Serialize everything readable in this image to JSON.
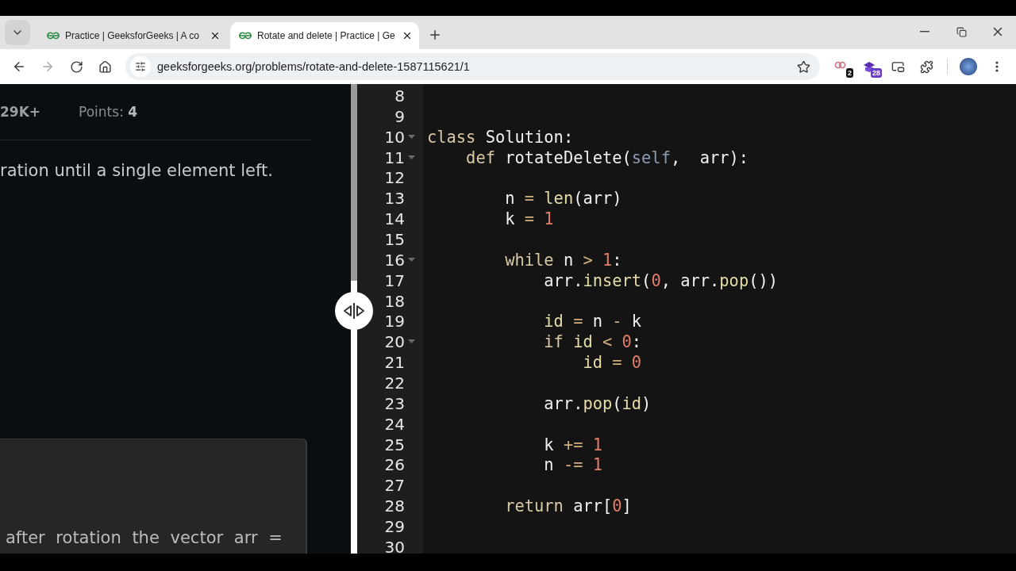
{
  "browser": {
    "tabs": [
      {
        "title": "Practice | GeeksforGeeks | A co",
        "selected": false
      },
      {
        "title": "Rotate and delete | Practice | Ge",
        "selected": true
      }
    ],
    "forward_disabled": true,
    "url": "geeksforgeeks.org/problems/rotate-and-delete-1587115621/1",
    "extensions": [
      {
        "kind": "rings",
        "badge": "2"
      },
      {
        "kind": "cap",
        "badge": "28"
      }
    ]
  },
  "problem": {
    "stats": [
      {
        "value": "29K+"
      },
      {
        "label": "Points:",
        "value": "4"
      }
    ],
    "description": "ration until a single element left.",
    "example_text": "after rotation the vector arr ="
  },
  "editor": {
    "lines": [
      {
        "number": "8"
      },
      {
        "number": "9"
      },
      {
        "number": "10",
        "foldable": true,
        "tokens": [
          {
            "kind": "keyword",
            "text": "class "
          },
          {
            "kind": "plain",
            "text": "Solution:"
          }
        ]
      },
      {
        "number": "11",
        "foldable": true,
        "tokens": [
          {
            "kind": "keyword",
            "text": "    def "
          },
          {
            "kind": "plain",
            "text": "rotateDelete("
          },
          {
            "kind": "self",
            "text": "self"
          },
          {
            "kind": "plain",
            "text": ",  arr):"
          }
        ]
      },
      {
        "number": "12"
      },
      {
        "number": "13",
        "tokens": [
          {
            "kind": "plain",
            "text": "        n "
          },
          {
            "kind": "operator",
            "text": "= "
          },
          {
            "kind": "function",
            "text": "len"
          },
          {
            "kind": "plain",
            "text": "(arr)"
          }
        ]
      },
      {
        "number": "14",
        "tokens": [
          {
            "kind": "plain",
            "text": "        k "
          },
          {
            "kind": "operator",
            "text": "= "
          },
          {
            "kind": "number",
            "text": "1"
          }
        ]
      },
      {
        "number": "15"
      },
      {
        "number": "16",
        "foldable": true,
        "tokens": [
          {
            "kind": "keyword",
            "text": "        while "
          },
          {
            "kind": "plain",
            "text": "n "
          },
          {
            "kind": "operator",
            "text": "> "
          },
          {
            "kind": "number",
            "text": "1"
          },
          {
            "kind": "plain",
            "text": ":"
          }
        ]
      },
      {
        "number": "17",
        "tokens": [
          {
            "kind": "plain",
            "text": "            arr."
          },
          {
            "kind": "function",
            "text": "insert"
          },
          {
            "kind": "plain",
            "text": "("
          },
          {
            "kind": "number",
            "text": "0"
          },
          {
            "kind": "plain",
            "text": ", arr."
          },
          {
            "kind": "function",
            "text": "pop"
          },
          {
            "kind": "plain",
            "text": "())"
          }
        ]
      },
      {
        "number": "18"
      },
      {
        "number": "19",
        "tokens": [
          {
            "kind": "function",
            "text": "            id "
          },
          {
            "kind": "operator",
            "text": "= "
          },
          {
            "kind": "plain",
            "text": "n "
          },
          {
            "kind": "operator",
            "text": "- "
          },
          {
            "kind": "plain",
            "text": "k"
          }
        ]
      },
      {
        "number": "20",
        "foldable": true,
        "tokens": [
          {
            "kind": "keyword",
            "text": "            if "
          },
          {
            "kind": "function",
            "text": "id "
          },
          {
            "kind": "operator",
            "text": "< "
          },
          {
            "kind": "number",
            "text": "0"
          },
          {
            "kind": "plain",
            "text": ":"
          }
        ]
      },
      {
        "number": "21",
        "tokens": [
          {
            "kind": "function",
            "text": "                id "
          },
          {
            "kind": "operator",
            "text": "= "
          },
          {
            "kind": "number",
            "text": "0"
          }
        ]
      },
      {
        "number": "22"
      },
      {
        "number": "23",
        "tokens": [
          {
            "kind": "plain",
            "text": "            arr."
          },
          {
            "kind": "function",
            "text": "pop"
          },
          {
            "kind": "plain",
            "text": "("
          },
          {
            "kind": "function",
            "text": "id"
          },
          {
            "kind": "plain",
            "text": ")"
          }
        ]
      },
      {
        "number": "24"
      },
      {
        "number": "25",
        "tokens": [
          {
            "kind": "plain",
            "text": "            k "
          },
          {
            "kind": "operator",
            "text": "+= "
          },
          {
            "kind": "number",
            "text": "1"
          }
        ]
      },
      {
        "number": "26",
        "tokens": [
          {
            "kind": "plain",
            "text": "            n "
          },
          {
            "kind": "operator",
            "text": "-= "
          },
          {
            "kind": "number",
            "text": "1"
          }
        ]
      },
      {
        "number": "27"
      },
      {
        "number": "28",
        "tokens": [
          {
            "kind": "keyword",
            "text": "        return "
          },
          {
            "kind": "plain",
            "text": "arr["
          },
          {
            "kind": "number",
            "text": "0"
          },
          {
            "kind": "plain",
            "text": "]"
          }
        ]
      },
      {
        "number": "29"
      },
      {
        "number": "30"
      }
    ]
  }
}
